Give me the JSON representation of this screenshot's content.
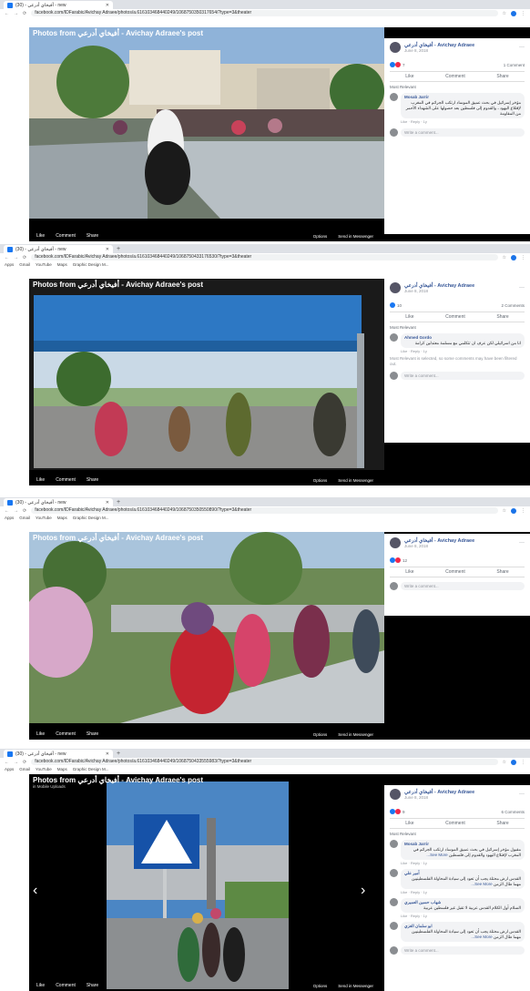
{
  "browser": {
    "tab_title": "(30) - ‏أفيخاي أدرعي‏ - new",
    "url_1": "facebook.com/IDFarabic/Avichay Adraee/photos/a.616103468440249/1068750350317654/?type=3&theater",
    "url_2": "facebook.com/IDFarabic/Avichay Adraee/photos/a.616103468440249/1068750433176530/?type=3&theater",
    "url_3": "facebook.com/IDFarabic/Avichay Adraee/photos/a.616103468440249/1068750350550890/?type=3&theater",
    "url_4": "facebook.com/IDFarabic/Avichay Adraee/photos/a.616103468440249/1068750433555983/?type=3&theater",
    "bookmarks": [
      "Apps",
      "Gmail",
      "YouTube",
      "Maps",
      "Graphic Design M..."
    ]
  },
  "viewer": {
    "header": "Photos from ‏أفيخاي أدرعي‏ - Avichay Adraee's post",
    "subheader": "in Mobile Uploads",
    "like": "Like",
    "comment": "Comment",
    "share": "Share",
    "options": "Options",
    "send": "Send in Messenger"
  },
  "panel": {
    "author": "‏أفيخاي أدرعي‏ - Avichay Adraee",
    "date": "June 8, 2018",
    "like": "Like",
    "comment": "Comment",
    "share": "Share",
    "most_relevant": "Most Relevant",
    "write": "Write a comment...",
    "reply": "Like · Reply · 1y",
    "see_more": "See More..."
  },
  "shot1": {
    "reaction_count": "7",
    "comments": "1 Comment",
    "commenter": "Mosab Jarrir",
    "comment_text": "مؤخر إسرائيل في بحث عميق الموساد ارتكب الجرائم في المغرب لإقتلاع اليهود ، والقدوم إلى فلسطين بعد حصولها على الشهداء الأحمر من المقاومة"
  },
  "shot2": {
    "reaction_count": "10",
    "comments": "2 Comments",
    "commenter": "Ahmed Gordo",
    "comment_text": "انا من اسرائيلي لكن عرف ان تتكلمي مع مسلمة معتدلين كرامة",
    "note": "Most Relevant is selected, so some comments may have been filtered out."
  },
  "shot3": {
    "reaction_count": "12"
  },
  "shot4": {
    "reaction_count": "9",
    "comments": "6 Comments",
    "c1_name": "Mosab Jarrir",
    "c1_text": "مقبول مؤخر إسرائيل في بحث عميق الموساد ارتكب الجرائم في المغرب لإقتلاع اليهود والقدوم إلى فلسطين",
    "c2_name": "أمير علي",
    "c2_text": "القدس ارض محتلة يجب أن تعود إلى سيادة المحاولة الفلسطينيين مهما طال الزمن",
    "c3_name": "شهاب حسين العميري",
    "c3_text": "السلام أول الكلام القدس عربية لا تقبل غير فلسطين عربية",
    "c4_name": "ابو سلمان الغزي",
    "c4_text": "القدس ارض محتلة يجب أن تعود إلى سيادة المحاولة الفلسطينيين مهما طال الزمن"
  }
}
